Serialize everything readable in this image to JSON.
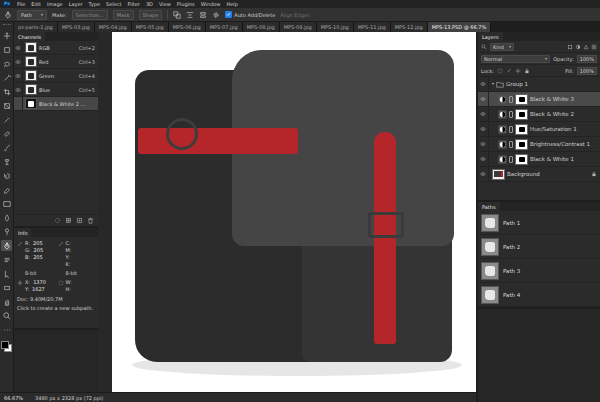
{
  "app": {
    "logo": "Ps"
  },
  "menu": [
    "File",
    "Edit",
    "Image",
    "Layer",
    "Type",
    "Select",
    "Filter",
    "3D",
    "View",
    "Plugins",
    "Window",
    "Help"
  ],
  "options": {
    "mode": "Path",
    "make": "Make:",
    "buttons": [
      "Selection...",
      "Mask",
      "Shape"
    ],
    "auto_add_delete": {
      "label": "Auto Add/Delete",
      "checked": true
    },
    "align_edges": {
      "label": "Align Edges",
      "disabled": true
    }
  },
  "toolbar": {
    "tools": [
      {
        "selected": false
      },
      {
        "selected": false
      },
      {
        "selected": false
      },
      {
        "selected": false
      },
      {
        "selected": false
      },
      {
        "selected": false
      },
      {
        "selected": false
      },
      {
        "selected": false
      },
      {
        "selected": false
      },
      {
        "selected": false
      },
      {
        "selected": false
      },
      {
        "selected": false
      },
      {
        "selected": false
      },
      {
        "selected": false
      },
      {
        "selected": false
      },
      {
        "selected": true
      },
      {
        "selected": false
      },
      {
        "selected": false
      },
      {
        "selected": false
      },
      {
        "selected": false
      },
      {
        "selected": false
      },
      {
        "selected": false
      }
    ]
  },
  "tabs": [
    {
      "label": "ps-parts-1.jpg",
      "selected": false
    },
    {
      "label": "MPS-03.jpg",
      "selected": false
    },
    {
      "label": "MPS-04.jpg",
      "selected": false
    },
    {
      "label": "MPS-05.jpg",
      "selected": false
    },
    {
      "label": "MPS-06.jpg",
      "selected": false
    },
    {
      "label": "MPS-07.jpg",
      "selected": false
    },
    {
      "label": "MPS-08.jpg",
      "selected": false
    },
    {
      "label": "MPS-09.jpg",
      "selected": false
    },
    {
      "label": "MPS-10.jpg",
      "selected": false
    },
    {
      "label": "MPS-11.jpg",
      "selected": false
    },
    {
      "label": "MPS-12.jpg",
      "selected": false
    },
    {
      "label": "MPS-13.PSD @ 66.7%",
      "selected": true
    }
  ],
  "channels": {
    "title": "Channels",
    "rows": [
      {
        "name": "RGB",
        "shortcut": "Ctrl+2",
        "visible": true,
        "selected": false
      },
      {
        "name": "Red",
        "shortcut": "Ctrl+3",
        "visible": true,
        "selected": false
      },
      {
        "name": "Green",
        "shortcut": "Ctrl+4",
        "visible": true,
        "selected": false
      },
      {
        "name": "Blue",
        "shortcut": "Ctrl+5",
        "visible": true,
        "selected": false
      },
      {
        "name": "Black & White 2 ...",
        "visible": false,
        "selected": true
      }
    ]
  },
  "info": {
    "title": "Info",
    "color_left": [
      {
        "label": "R:",
        "value": "205"
      },
      {
        "label": "G:",
        "value": "205"
      },
      {
        "label": "B:",
        "value": "205"
      }
    ],
    "color_right": [
      {
        "label": "C:"
      },
      {
        "label": "M:"
      },
      {
        "label": "Y:"
      },
      {
        "label": "K:"
      }
    ],
    "bit_left": "8-bit",
    "bit_right": "8-bit",
    "position": [
      {
        "label": "X:",
        "value": "1370"
      },
      {
        "label": "Y:",
        "value": "1627"
      }
    ],
    "size": [
      {
        "label": "W:"
      },
      {
        "label": "H:"
      }
    ],
    "doc": "Doc: 9.40M/20.7M",
    "hint": "Click to create a new subpath."
  },
  "layers": {
    "title": "Layers",
    "filter": "Kind",
    "blend": "Normal",
    "opacity_label": "Opacity:",
    "opacity": "100%",
    "lock_label": "Lock:",
    "fill_label": "Fill:",
    "fill": "100%",
    "rows": [
      {
        "name": "Group 1",
        "kind": "group",
        "expanded": true,
        "visible": true,
        "selected": false,
        "in_group": false
      },
      {
        "name": "Black & White 3",
        "kind": "adjustment",
        "visible": true,
        "selected": true,
        "in_group": true
      },
      {
        "name": "Black & White 2",
        "kind": "adjustment",
        "visible": true,
        "selected": false,
        "in_group": true
      },
      {
        "name": "Hue/Saturation 1",
        "kind": "adjustment",
        "visible": true,
        "selected": false,
        "in_group": true
      },
      {
        "name": "Brightness/Contrast 1",
        "kind": "adjustment",
        "visible": true,
        "selected": false,
        "in_group": true
      },
      {
        "name": "Black & White 1",
        "kind": "adjustment",
        "visible": true,
        "selected": false,
        "in_group": true
      },
      {
        "name": "Background",
        "kind": "background",
        "visible": true,
        "selected": false,
        "in_group": false
      }
    ]
  },
  "paths": {
    "title": "Paths",
    "rows": [
      {
        "name": "Path 1",
        "selected": false
      },
      {
        "name": "Path 2",
        "selected": false
      },
      {
        "name": "Path 3",
        "selected": false
      },
      {
        "name": "Path 4",
        "selected": false
      }
    ]
  },
  "status": {
    "zoom": "66.67%",
    "size": "3480 px x 2328 px (72 ppi)"
  }
}
